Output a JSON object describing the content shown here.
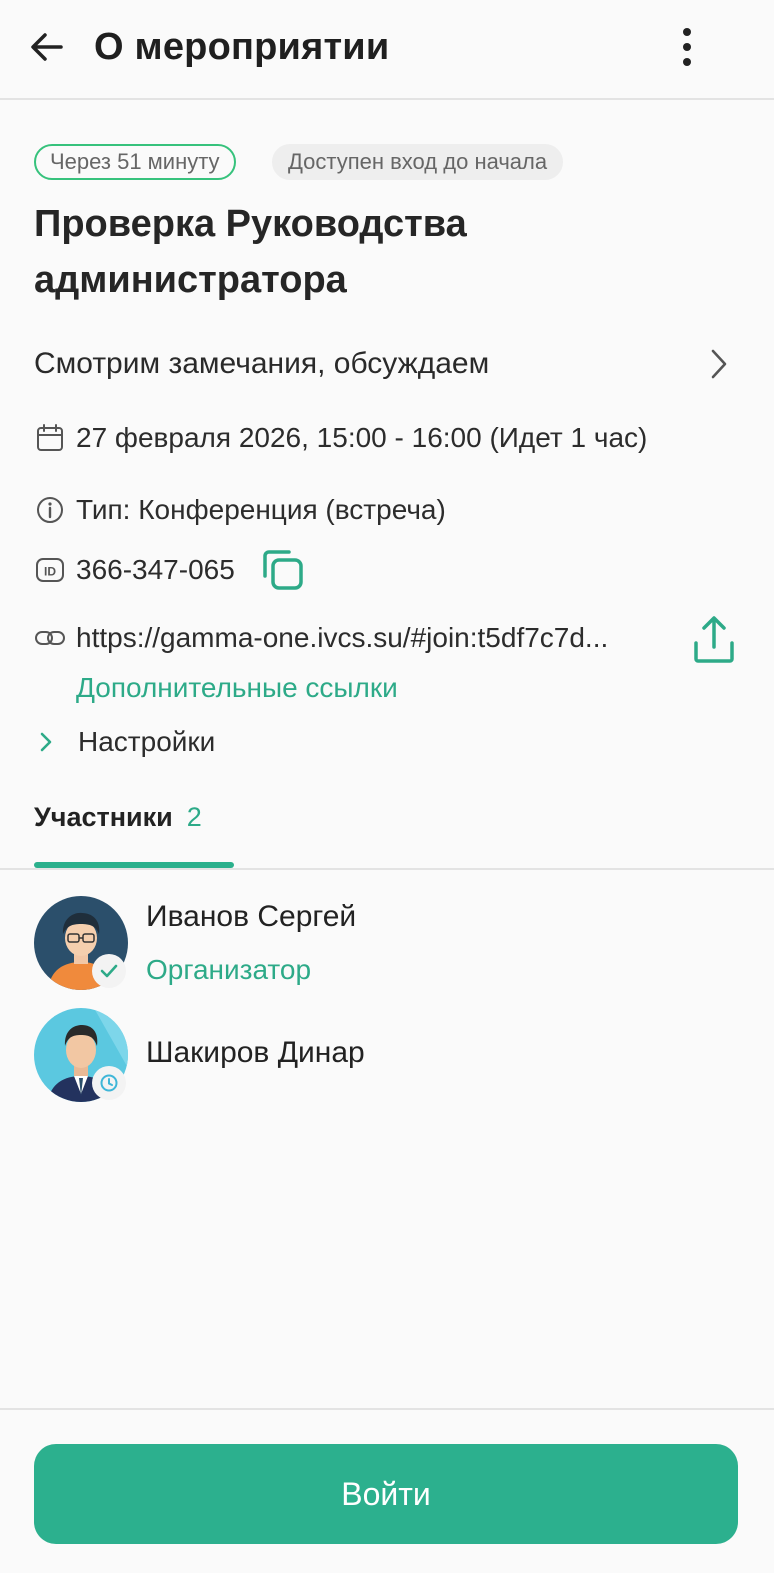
{
  "header": {
    "title": "О мероприятии",
    "back_icon": "arrow-left-icon",
    "menu_icon": "more-vertical-icon"
  },
  "badges": {
    "time": "Через 51 минуту",
    "access": "Доступен вход до начала"
  },
  "event": {
    "title": "Проверка Руководства администратора",
    "description": "Смотрим замечания, обсуждаем",
    "datetime": "27 февраля 2026, 15:00 - 16:00 (Идет 1 час)",
    "type": "Тип: Конференция (встреча)",
    "id": "366-347-065",
    "link": "https://gamma-one.ivcs.su/#join:t5df7c7d...",
    "more_links": "Дополнительные ссылки",
    "settings": "Настройки"
  },
  "tabs": {
    "participants_label": "Участники",
    "participants_count": "2"
  },
  "participants": [
    {
      "name": "Иванов Сергей",
      "role": "Организатор",
      "status_icon": "check-icon"
    },
    {
      "name": "Шакиров Динар",
      "role": "",
      "status_icon": "clock-icon"
    }
  ],
  "footer": {
    "join_label": "Войти"
  },
  "colors": {
    "accent": "#2cb08e",
    "badge_border": "#36c27c",
    "text": "#222222"
  }
}
